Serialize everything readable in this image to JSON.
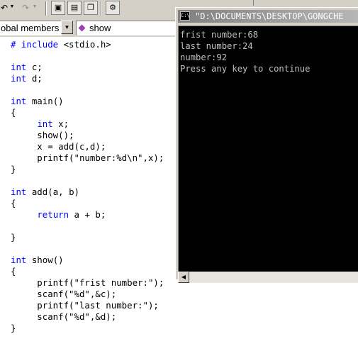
{
  "toolbar": {
    "icons": [
      "undo-icon",
      "redo-icon",
      "workspace-icon",
      "output-icon",
      "window-list-icon",
      "build-icon"
    ]
  },
  "combos": {
    "members_text": "obal members",
    "function_text": "show"
  },
  "editor": {
    "lines": [
      {
        "kw": "# include",
        "text": " <stdio.h>"
      },
      {
        "kw": "",
        "text": ""
      },
      {
        "kw": "int",
        "text": " c;"
      },
      {
        "kw": "int",
        "text": " d;"
      },
      {
        "kw": "",
        "text": ""
      },
      {
        "kw": "int",
        "text": " main()"
      },
      {
        "kw": "",
        "text": "{"
      },
      {
        "kw": "",
        "text": "     ",
        "kw2": "int",
        "text2": " x;"
      },
      {
        "kw": "",
        "text": "     show();"
      },
      {
        "kw": "",
        "text": "     x = add(c,d);"
      },
      {
        "kw": "",
        "text": "     printf(\"number:%d\\n\",x);"
      },
      {
        "kw": "",
        "text": "}"
      },
      {
        "kw": "",
        "text": ""
      },
      {
        "kw": "int",
        "text": " add(a, b)"
      },
      {
        "kw": "",
        "text": "{"
      },
      {
        "kw": "",
        "text": "     ",
        "kw2": "return",
        "text2": " a + b;"
      },
      {
        "kw": "",
        "text": ""
      },
      {
        "kw": "",
        "text": "}"
      },
      {
        "kw": "",
        "text": ""
      },
      {
        "kw": "int",
        "text": " show()"
      },
      {
        "kw": "",
        "text": "{"
      },
      {
        "kw": "",
        "text": "     printf(\"frist number:\");"
      },
      {
        "kw": "",
        "text": "     scanf(\"%d\",&c);"
      },
      {
        "kw": "",
        "text": "     printf(\"last number:\");"
      },
      {
        "kw": "",
        "text": "     scanf(\"%d\",&d);"
      },
      {
        "kw": "",
        "text": "}"
      }
    ]
  },
  "console": {
    "title": "\"D:\\DOCUMENTS\\DESKTOP\\GONGCHE",
    "output": [
      "frist number:68",
      "last number:24",
      "number:92",
      "Press any key to continue"
    ]
  },
  "colors": {
    "keyword": "#0000ff",
    "console_bg": "#000000",
    "console_text": "#c0c0c0",
    "chrome": "#d4d0c8"
  }
}
